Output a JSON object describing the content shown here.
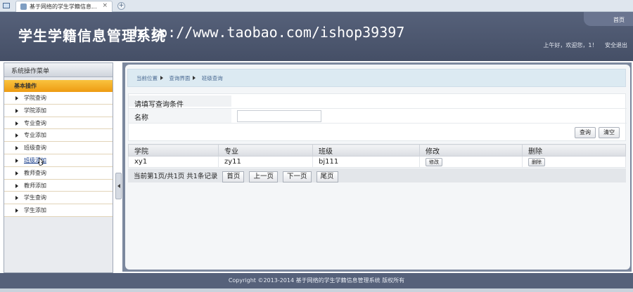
{
  "browser": {
    "tab_title": "基于网络的学生学籍信息...",
    "tab_close": "×",
    "new_tab": "+"
  },
  "header": {
    "home_link": "首页",
    "system_title": "学生学籍信息管理系统",
    "watermark": "http://www.taobao.com/ishop39397",
    "greeting": "上午好，欢迎您，1！",
    "logout": "安全退出"
  },
  "sidebar": {
    "heading": "系统操作菜单",
    "group": "基本操作",
    "items": [
      {
        "label": "学院查询"
      },
      {
        "label": "学院添加"
      },
      {
        "label": "专业查询"
      },
      {
        "label": "专业添加"
      },
      {
        "label": "班级查询"
      },
      {
        "label": "班级添加"
      },
      {
        "label": "教师查询"
      },
      {
        "label": "教师添加"
      },
      {
        "label": "学生查询"
      },
      {
        "label": "学生添加"
      }
    ]
  },
  "breadcrumb": {
    "items": [
      "当前位置",
      "查询界面",
      "班级查询"
    ]
  },
  "search": {
    "title": "请填写查询条件",
    "label": "名称",
    "value": "",
    "query_button": "查询",
    "clear_button": "清空"
  },
  "table": {
    "headers": [
      "学院",
      "专业",
      "班级",
      "修改",
      "删除"
    ],
    "rows": [
      {
        "college": "xy1",
        "major": "zy11",
        "class": "bj111",
        "edit": "修改",
        "delete": "删除"
      }
    ]
  },
  "pager": {
    "summary": "当前第1页/共1页  共1条记录",
    "first": "首页",
    "prev": "上一页",
    "next": "下一页",
    "last": "尾页"
  },
  "footer": {
    "copyright": "Copyright ©2013-2014 基于网络的学生学籍信息管理系统 版权所有"
  }
}
